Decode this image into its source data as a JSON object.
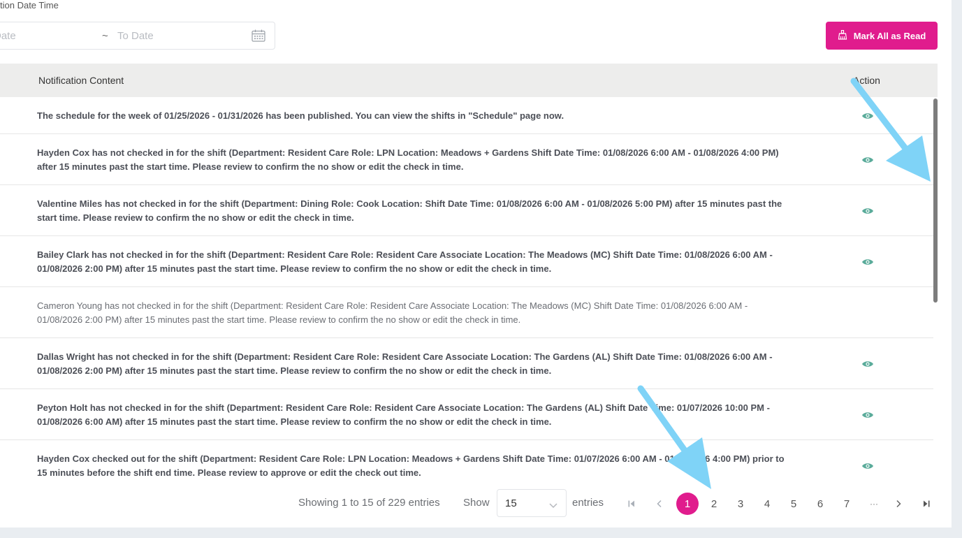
{
  "filter": {
    "label": "tion Date Time",
    "from_placeholder": "Date",
    "separator": "~",
    "to_placeholder": "To Date"
  },
  "toolbar": {
    "mark_all_label": "Mark All as Read"
  },
  "table": {
    "columns": [
      "Notification Content",
      "Action"
    ],
    "rows": [
      {
        "text": "The schedule for the week of 01/25/2026 - 01/31/2026 has been published. You can view the shifts in \"Schedule\" page now.",
        "unread": true
      },
      {
        "text": "Hayden Cox has not checked in for the shift (Department: Resident Care Role: LPN Location: Meadows + Gardens Shift Date Time: 01/08/2026 6:00 AM - 01/08/2026 4:00 PM) after 15 minutes past the start time. Please review to confirm the no show or edit the check in time.",
        "unread": true
      },
      {
        "text": "Valentine Miles has not checked in for the shift (Department: Dining Role: Cook Location: Shift Date Time: 01/08/2026 6:00 AM - 01/08/2026 5:00 PM) after 15 minutes past the start time. Please review to confirm the no show or edit the check in time.",
        "unread": true
      },
      {
        "text": "Bailey Clark has not checked in for the shift (Department: Resident Care Role: Resident Care Associate Location: The Meadows (MC) Shift Date Time: 01/08/2026 6:00 AM - 01/08/2026 2:00 PM) after 15 minutes past the start time. Please review to confirm the no show or edit the check in time.",
        "unread": true
      },
      {
        "text": "Cameron Young has not checked in for the shift (Department: Resident Care Role: Resident Care Associate Location: The Meadows (MC) Shift Date Time: 01/08/2026 6:00 AM - 01/08/2026 2:00 PM) after 15 minutes past the start time. Please review to confirm the no show or edit the check in time.",
        "unread": false
      },
      {
        "text": "Dallas Wright has not checked in for the shift (Department: Resident Care Role: Resident Care Associate Location: The Gardens (AL) Shift Date Time: 01/08/2026 6:00 AM - 01/08/2026 2:00 PM) after 15 minutes past the start time. Please review to confirm the no show or edit the check in time.",
        "unread": true
      },
      {
        "text": "Peyton Holt has not checked in for the shift (Department: Resident Care Role: Resident Care Associate Location: The Gardens (AL) Shift Date Time: 01/07/2026 10:00 PM - 01/08/2026 6:00 AM) after 15 minutes past the start time. Please review to confirm the no show or edit the check in time.",
        "unread": true
      },
      {
        "text": "Hayden Cox checked out for the shift (Department: Resident Care Role: LPN Location: Meadows + Gardens Shift Date Time: 01/07/2026 6:00 AM - 01/07/2026 4:00 PM) prior to 15 minutes before the shift end time. Please review to approve or edit the check out time.",
        "unread": true
      }
    ]
  },
  "pagination": {
    "summary": "Showing 1 to 15 of 229 entries",
    "show_label": "Show",
    "page_size": "15",
    "entries_label": "entries",
    "pages": [
      "1",
      "2",
      "3",
      "4",
      "5",
      "6",
      "7"
    ],
    "ellipsis": "···",
    "current_page": "1"
  },
  "colors": {
    "accent": "#e01c8d",
    "eye_icon": "#5aab9a",
    "annotation_arrow": "#7fd3f7"
  }
}
